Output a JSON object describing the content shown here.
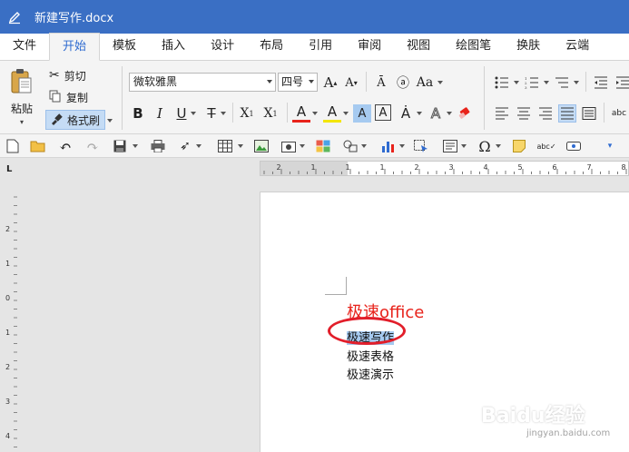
{
  "window": {
    "title": "新建写作.docx"
  },
  "tabs": [
    {
      "label": "文件"
    },
    {
      "label": "开始"
    },
    {
      "label": "模板"
    },
    {
      "label": "插入"
    },
    {
      "label": "设计"
    },
    {
      "label": "布局"
    },
    {
      "label": "引用"
    },
    {
      "label": "审阅"
    },
    {
      "label": "视图"
    },
    {
      "label": "绘图笔"
    },
    {
      "label": "换肤"
    },
    {
      "label": "云端"
    }
  ],
  "active_tab": "开始",
  "clipboard": {
    "paste": "粘贴",
    "cut": "剪切",
    "copy": "复制",
    "format_painter": "格式刷"
  },
  "font": {
    "family": "微软雅黑",
    "size": "四号"
  },
  "ruler": {
    "h_labels": [
      "2",
      "1",
      "1",
      "1",
      "2",
      "3",
      "4",
      "5",
      "6",
      "7",
      "8"
    ],
    "v_labels": [
      "2",
      "1",
      "0",
      "1",
      "2",
      "3",
      "4"
    ],
    "corner": "L"
  },
  "document": {
    "heading": "极速office",
    "items": [
      "极速写作",
      "极速表格",
      "极速演示"
    ]
  },
  "watermark": {
    "text": "Baidu经验",
    "sub": "jingyan.baidu.com"
  },
  "colors": {
    "titlebar": "#3a6fc4",
    "accent": "#2f6bd0",
    "heading": "#e8231b",
    "annotation": "#e21e2a",
    "selection": "#a6caf0"
  }
}
